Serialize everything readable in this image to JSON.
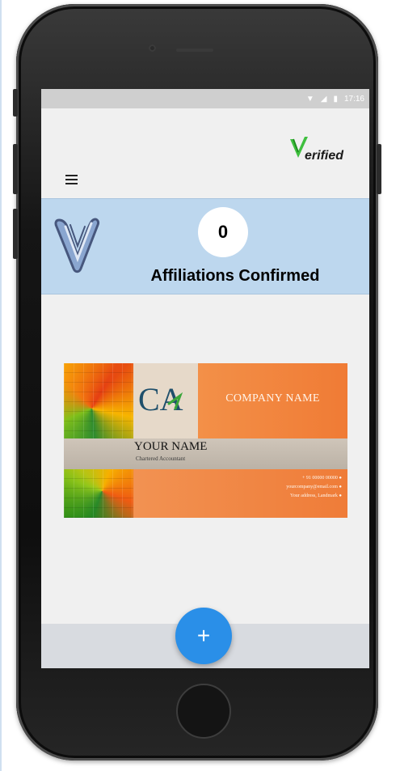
{
  "status_bar": {
    "time": "17:16",
    "icons": [
      "wifi-icon",
      "signal-icon",
      "battery-icon"
    ]
  },
  "header": {
    "menu_icon": "hamburger-menu-icon",
    "brand_text": "erified",
    "brand_logo_icon": "verified-v-logo-icon"
  },
  "banner": {
    "logo_icon": "v-clip-logo-icon",
    "count": "0",
    "label": "Affiliations Confirmed"
  },
  "card": {
    "logo_text": "CA",
    "company_name": "COMPANY NAME",
    "person_name": "YOUR NAME",
    "title": "Chartered Accountant",
    "phone": "+ 91 00000 00000 ●",
    "email": "yourcompany@email.com ●",
    "address": "Your address, Landmark ●"
  },
  "fab": {
    "label": "+",
    "icon": "add-icon"
  },
  "colors": {
    "banner_bg": "#bdd7ee",
    "fab_bg": "#2a8fe8",
    "card_orange": "#f07f3a",
    "brand_green": "#3fbf3f"
  }
}
